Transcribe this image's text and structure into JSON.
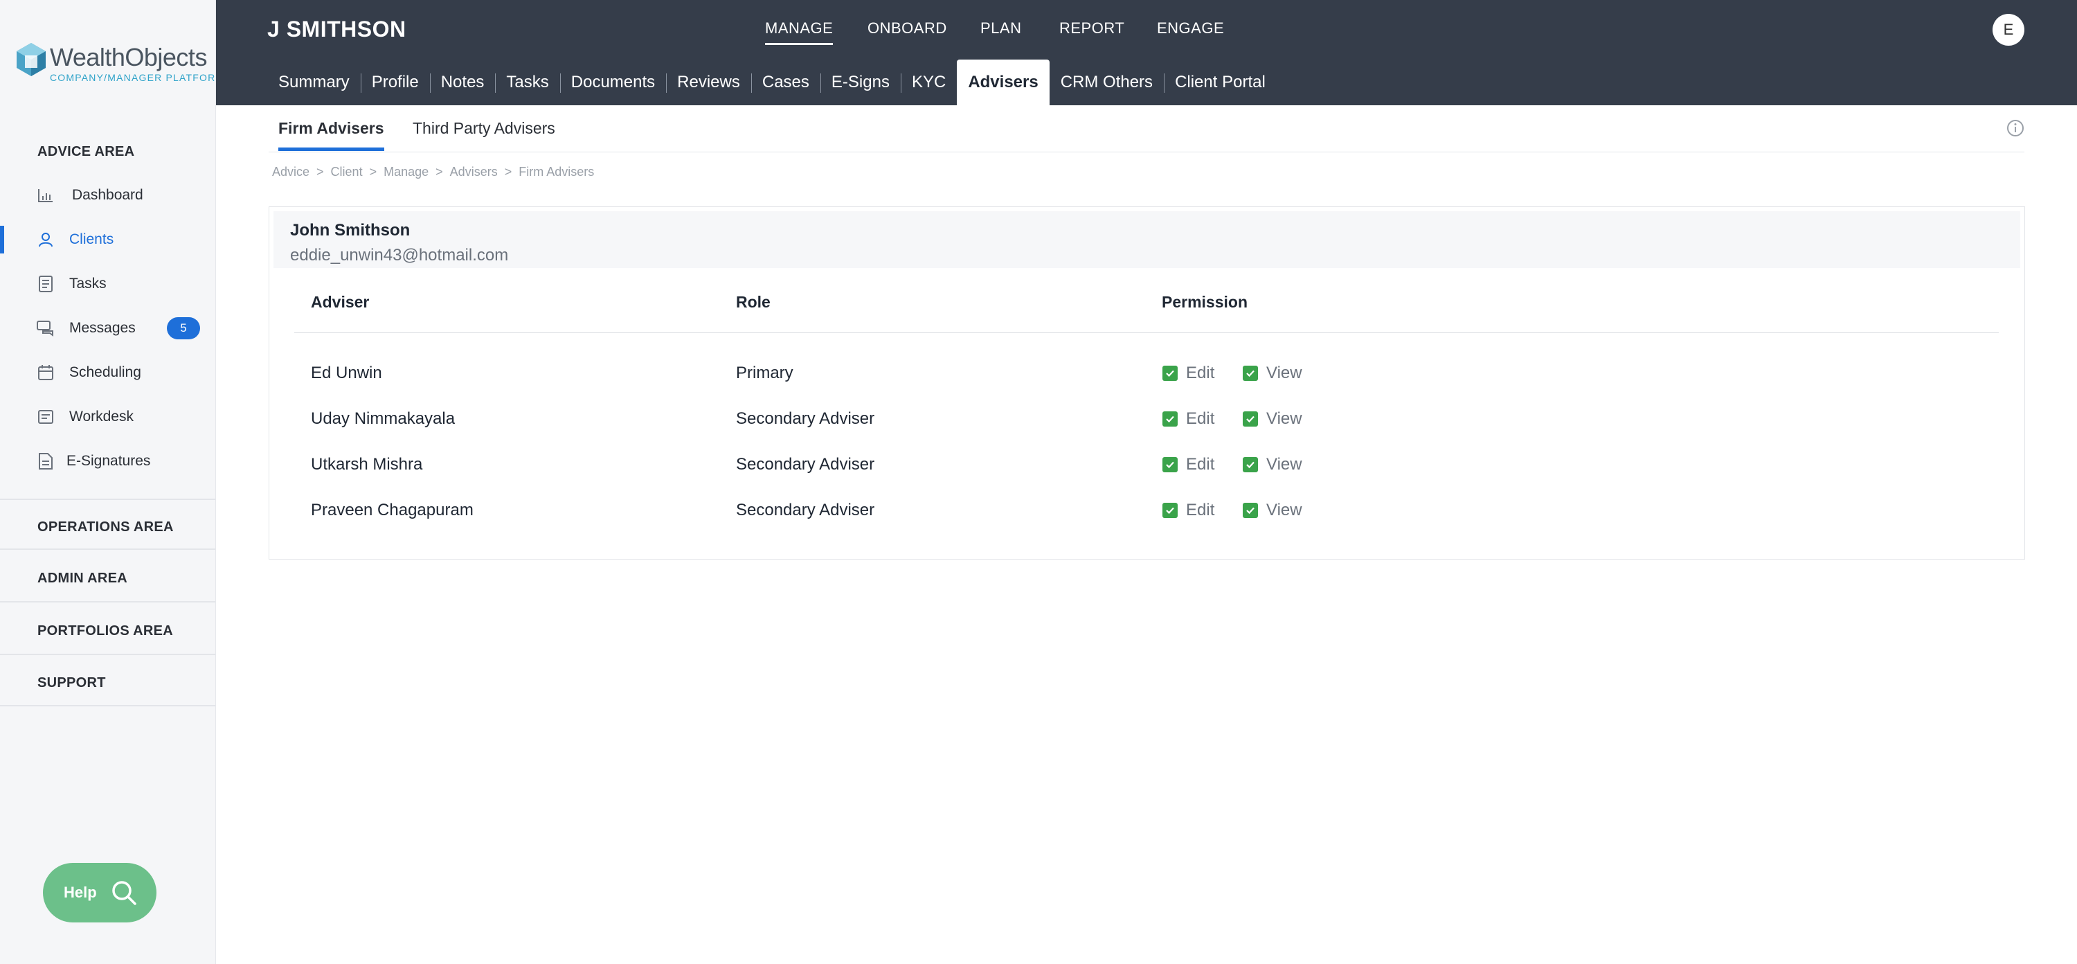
{
  "brand": {
    "name": "WealthObjects",
    "tagline": "COMPANY/MANAGER PLATFORM"
  },
  "sidebar": {
    "advice_area": "ADVICE AREA",
    "items": [
      {
        "label": "Dashboard",
        "icon": "bar-chart-icon"
      },
      {
        "label": "Clients",
        "icon": "user-icon",
        "active": true
      },
      {
        "label": "Tasks",
        "icon": "task-list-icon"
      },
      {
        "label": "Messages",
        "icon": "chat-icon",
        "badge": "5"
      },
      {
        "label": "Scheduling",
        "icon": "calendar-icon"
      },
      {
        "label": "Workdesk",
        "icon": "workdesk-icon"
      },
      {
        "label": "E-Signatures",
        "icon": "document-icon"
      }
    ],
    "operations_area": "OPERATIONS AREA",
    "admin_area": "ADMIN AREA",
    "portfolios_area": "PORTFOLIOS AREA",
    "support": "SUPPORT",
    "help_label": "Help"
  },
  "header": {
    "client_name": "J SMITHSON",
    "main_nav": [
      "MANAGE",
      "ONBOARD",
      "PLAN",
      "REPORT",
      "ENGAGE"
    ],
    "avatar_letter": "E",
    "sub_nav": [
      "Summary",
      "Profile",
      "Notes",
      "Tasks",
      "Documents",
      "Reviews",
      "Cases",
      "E-Signs",
      "KYC",
      "Advisers",
      "CRM Others",
      "Client Portal"
    ],
    "sub_nav_active": "Advisers"
  },
  "tabs": [
    "Firm Advisers",
    "Third Party Advisers"
  ],
  "breadcrumb": [
    "Advice",
    "Client",
    "Manage",
    "Advisers",
    "Firm Advisers"
  ],
  "client": {
    "name": "John Smithson",
    "email": "eddie_unwin43@hotmail.com"
  },
  "table": {
    "headers": [
      "Adviser",
      "Role",
      "Permission"
    ],
    "rows": [
      {
        "adviser": "Ed Unwin",
        "role": "Primary",
        "edit": "Edit",
        "view": "View"
      },
      {
        "adviser": "Uday Nimmakayala",
        "role": "Secondary Adviser",
        "edit": "Edit",
        "view": "View"
      },
      {
        "adviser": "Utkarsh Mishra",
        "role": "Secondary Adviser",
        "edit": "Edit",
        "view": "View"
      },
      {
        "adviser": "Praveen Chagapuram",
        "role": "Secondary Adviser",
        "edit": "Edit",
        "view": "View"
      }
    ]
  },
  "colors": {
    "header_bg": "#353d4a",
    "accent": "#1e6fd9",
    "check": "#3aa34a",
    "help": "#6cc08a"
  }
}
